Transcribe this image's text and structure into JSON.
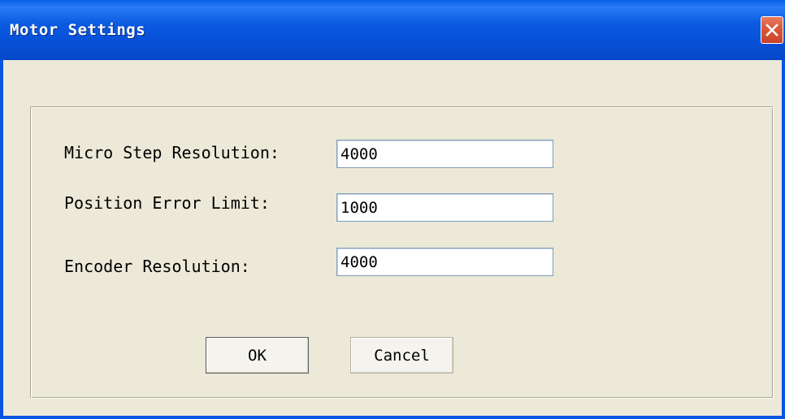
{
  "window": {
    "title": "Motor Settings"
  },
  "icons": {
    "close": "close-icon"
  },
  "form": {
    "fields": [
      {
        "label": "Micro Step Resolution:",
        "value": "4000"
      },
      {
        "label": "Position Error Limit:",
        "value": "1000"
      },
      {
        "label": "Encoder Resolution:",
        "value": "4000"
      }
    ]
  },
  "buttons": {
    "ok_label": "OK",
    "cancel_label": "Cancel"
  },
  "colors": {
    "titlebar": "#0a5fe8",
    "close_button": "#d9573a",
    "dialog_background": "#ece9d8"
  }
}
